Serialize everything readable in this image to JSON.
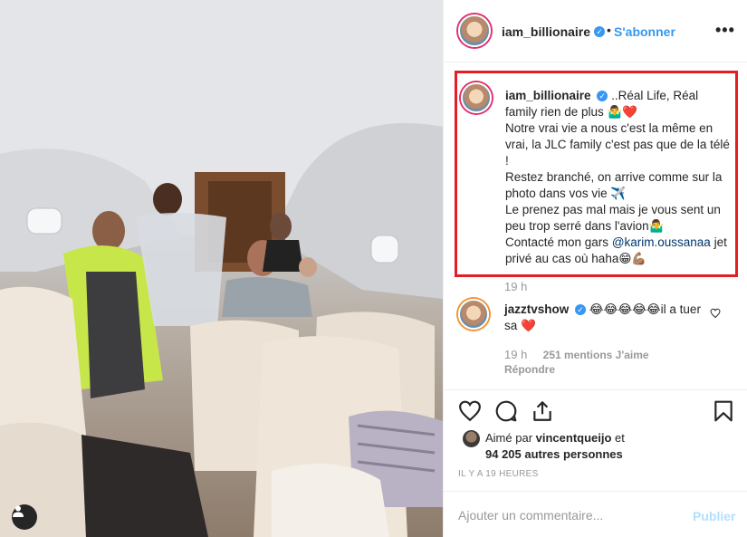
{
  "post": {
    "username": "iam_billionaire",
    "verified_mark": "✓",
    "separator": "•",
    "follow_label": "S'abonner",
    "more_label": "•••"
  },
  "caption": {
    "username": "iam_billionaire",
    "verified_mark": "✓",
    "line_1": " ..Réal Life, Réal family rien de plus 🤷‍♂️❤️",
    "line_2": "Notre vrai vie a nous c'est la même en vrai, la JLC family c'est pas que de la télé !",
    "line_3": "Restez branché, on arrive comme sur la photo dans vos vie ✈️",
    "line_4": "Le prenez pas mal mais je vous sent un peu trop serré dans l'avion🤷‍♂️",
    "line_5_prefix": "Contacté mon gars ",
    "mention": "@karim.oussanaa",
    "line_5_suffix": " jet privé au cas où haha😁💪🏽",
    "time": "19 h"
  },
  "comment": {
    "username": "jazztvshow",
    "verified_mark": "✓",
    "text": " 😂😂😂😂😂il a tuer sa ❤️",
    "time": "19 h",
    "likes": "251 mentions J'aime",
    "reply_label": "Répondre"
  },
  "engagement": {
    "liked_by_prefix": "Aimé par ",
    "liked_by_user": "vincentqueijo",
    "liked_by_suffix": " et",
    "others": "94 205 autres personnes",
    "posted_ago": "IL Y A 19 HEURES"
  },
  "composer": {
    "placeholder": "Ajouter un commentaire...",
    "publish_label": "Publier"
  },
  "icons": {
    "like": "heart-icon",
    "comment": "speech-bubble-icon",
    "share": "share-icon",
    "save": "bookmark-icon",
    "tags": "user-tag-icon",
    "comment_like": "small-heart-icon"
  },
  "colors": {
    "accent": "#3897f0",
    "highlight_border": "#e31f26",
    "muted_text": "#999999"
  }
}
